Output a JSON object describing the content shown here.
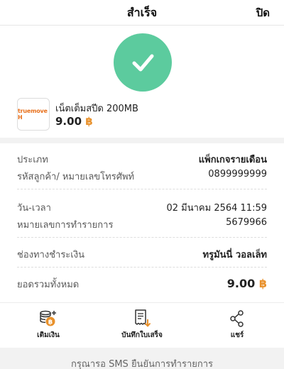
{
  "header": {
    "title": "สำเร็จ",
    "close_label": "ปิด"
  },
  "product": {
    "logo_text": "truemove H",
    "name": "เน็ตเต็มสปีด 200MB",
    "price": "9.00",
    "currency_symbol": "฿"
  },
  "details": {
    "type_label": "ประเภท",
    "type_value": "แพ็กเกจรายเดือน",
    "phone_label": "รหัสลูกค้า/ หมายเลขโทรศัพท์",
    "phone_value": "0899999999",
    "datetime_label": "วัน-เวลา",
    "datetime_value": "02 มีนาคม 2564 11:59",
    "txn_label": "หมายเลขการทำรายการ",
    "txn_value": "5679966",
    "channel_label": "ช่องทางชำระเงิน",
    "channel_value": "ทรูมันนี่ วอลเล็ท",
    "total_label": "ยอดรวมทั้งหมด",
    "total_value": "9.00",
    "currency_symbol": "฿"
  },
  "actions": {
    "topup_label": "เติมเงิน",
    "save_receipt_label": "บันทึกใบเสร็จ",
    "share_label": "แชร์"
  },
  "footer": {
    "text": "กรุณารอ SMS ยืนยันการทำรายการ"
  },
  "colors": {
    "success": "#5ccb9e",
    "baht": "#e8902a",
    "brand": "#e8711d"
  },
  "icons": [
    "check-icon",
    "coins-plus-icon",
    "receipt-download-icon",
    "share-icon"
  ]
}
